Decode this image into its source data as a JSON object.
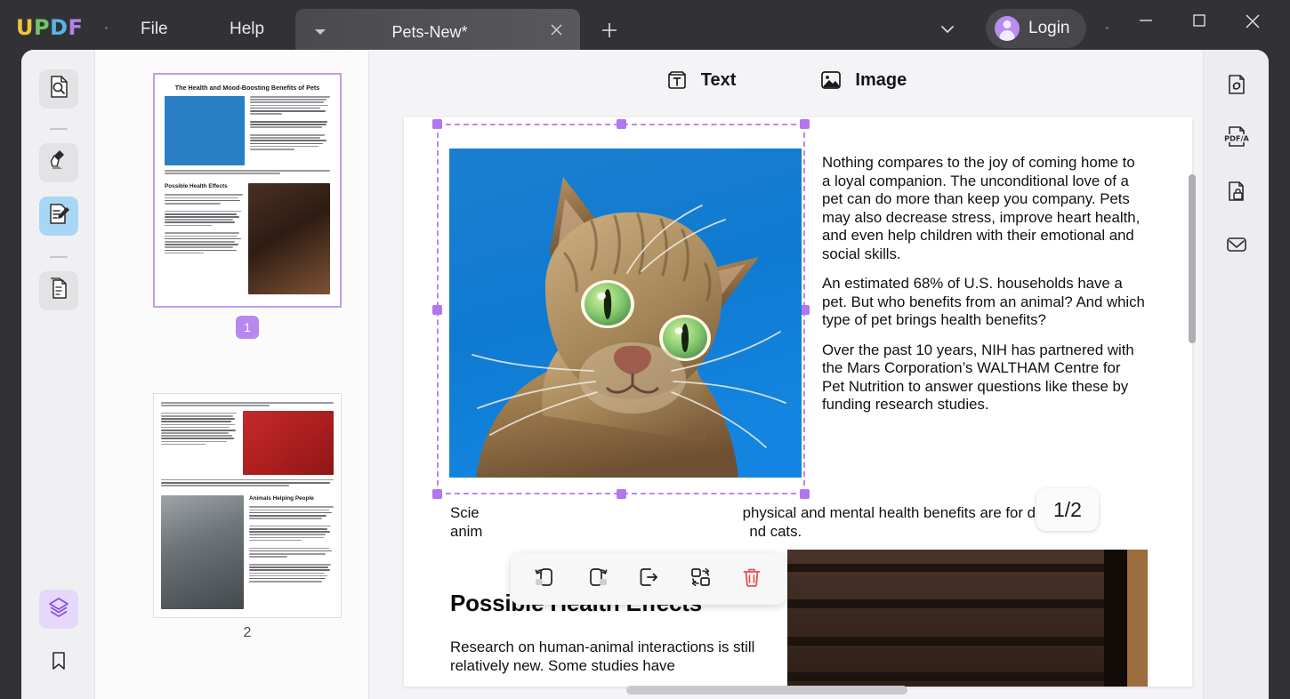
{
  "app": {
    "logo_letters": [
      "U",
      "P",
      "D",
      "F"
    ],
    "accent_purple": "#b888ef",
    "accent_blue": "#a8d7f5"
  },
  "titlebar": {
    "menus": [
      {
        "label": "File",
        "name": "menu-file"
      },
      {
        "label": "Help",
        "name": "menu-help"
      }
    ],
    "tab": {
      "title": "Pets-New*",
      "caret_icon": "chevron-down-icon",
      "close_icon": "close-icon"
    },
    "new_tab_label": "+",
    "tab_list_icon": "chevron-down-icon",
    "login_label": "Login",
    "window_controls": {
      "minimize": "minimize-icon",
      "maximize": "maximize-icon",
      "close": "close-icon"
    }
  },
  "left_rail": {
    "items": [
      {
        "name": "sidebar-item-search",
        "icon": "document-search-icon",
        "state": "hover"
      },
      {
        "name": "sidebar-item-highlight",
        "icon": "highlighter-icon",
        "state": "hover"
      },
      {
        "name": "sidebar-item-edit",
        "icon": "edit-document-icon",
        "state": "active-blue"
      },
      {
        "name": "sidebar-item-organize",
        "icon": "organize-pages-icon",
        "state": "hover"
      }
    ],
    "bottom_items": [
      {
        "name": "sidebar-item-layers",
        "icon": "layers-icon",
        "state": "active-purple"
      },
      {
        "name": "sidebar-item-bookmark",
        "icon": "bookmark-icon",
        "state": "normal"
      }
    ]
  },
  "thumbnails": {
    "pages": [
      {
        "number": "1",
        "selected": true,
        "title": "The Health and Mood-Boosting Benefits of Pets",
        "subheading": "Possible Health Effects"
      },
      {
        "number": "2",
        "selected": false,
        "title": "",
        "subheading": "Animals Helping People"
      }
    ]
  },
  "toolbar": {
    "text_label": "Text",
    "text_icon": "text-tool-icon",
    "image_label": "Image",
    "image_icon": "image-tool-icon"
  },
  "image_toolbar": {
    "buttons": [
      {
        "name": "rotate-left-button",
        "icon": "rotate-left-icon",
        "tooltip": "Rotate Left"
      },
      {
        "name": "rotate-right-button",
        "icon": "rotate-right-icon",
        "tooltip": "Rotate Right"
      },
      {
        "name": "extract-image-button",
        "icon": "extract-icon",
        "tooltip": "Extract"
      },
      {
        "name": "replace-image-button",
        "icon": "replace-icon",
        "tooltip": "Replace"
      },
      {
        "name": "delete-image-button",
        "icon": "trash-icon",
        "tooltip": "Delete",
        "color": "#e8504e"
      }
    ]
  },
  "document": {
    "page_indicator": "1/2",
    "selected_image": {
      "name": "cat-photo",
      "alt": "Tabby cat with green eyes on blue background"
    },
    "right_column": [
      "Nothing compares to the joy of coming home to a loyal companion. The unconditional love of a pet can do more than keep you company. Pets may also decrease stress, improve heart health,  and  even  help children  with  their emotional and social skills.",
      "An estimated 68% of U.S. households have a pet. But who benefits from an animal? And which type of pet brings health benefits?",
      "Over  the  past  10  years,  NIH  has partnered with the Mars Corporation’s WALTHAM Centre for  Pet  Nutrition  to answer  questions  like these by funding research studies."
    ],
    "caption_line1_start": "Scie",
    "caption_line1_end": "physical and mental health benefits are for different",
    "caption_line2_start": "anim",
    "caption_line2_end": "nd cats.",
    "heading2": "Possible Health Effects",
    "body2": "Research  on  human-animal  interactions is  still  relatively  new.  Some  studies  have",
    "bottom_image": {
      "name": "dog-cat-photo",
      "alt": "Dog resting beside a cat on wooden floor"
    }
  },
  "right_rail": {
    "items": [
      {
        "name": "convert-pdf-button",
        "icon": "convert-document-icon"
      },
      {
        "name": "pdfa-button",
        "icon": "pdfa-icon",
        "label": "PDF/A"
      },
      {
        "name": "protect-button",
        "icon": "document-lock-icon"
      },
      {
        "name": "share-email-button",
        "icon": "envelope-icon"
      }
    ]
  },
  "scrollbars": {
    "vertical": "vertical-scrollbar",
    "horizontal": "horizontal-scrollbar"
  }
}
